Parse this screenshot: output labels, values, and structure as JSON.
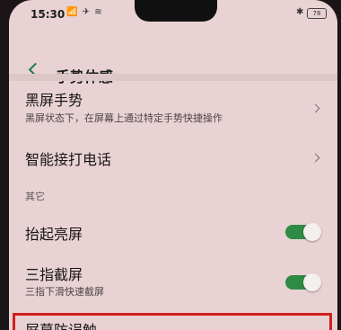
{
  "status_bar": {
    "time": "15:30",
    "status_icons": "📶 ✈ ≋",
    "bluetooth": "✱",
    "battery": "78"
  },
  "header": {
    "title": "手势体感"
  },
  "settings": {
    "items": [
      {
        "title": "黑屏手势",
        "subtitle": "黑屏状态下，在屏幕上通过特定手势快捷操作"
      },
      {
        "title": "智能接打电话"
      }
    ],
    "section_other": "其它",
    "toggles": [
      {
        "title": "抬起亮屏",
        "on": true
      },
      {
        "title": "三指截屏",
        "subtitle": "三指下滑快速截屏",
        "on": true
      },
      {
        "title": "屏幕防误触"
      }
    ]
  },
  "colors": {
    "accent": "#2f8a46",
    "highlight_border": "#d11f1f",
    "screen_background": "#e9d2d4"
  }
}
